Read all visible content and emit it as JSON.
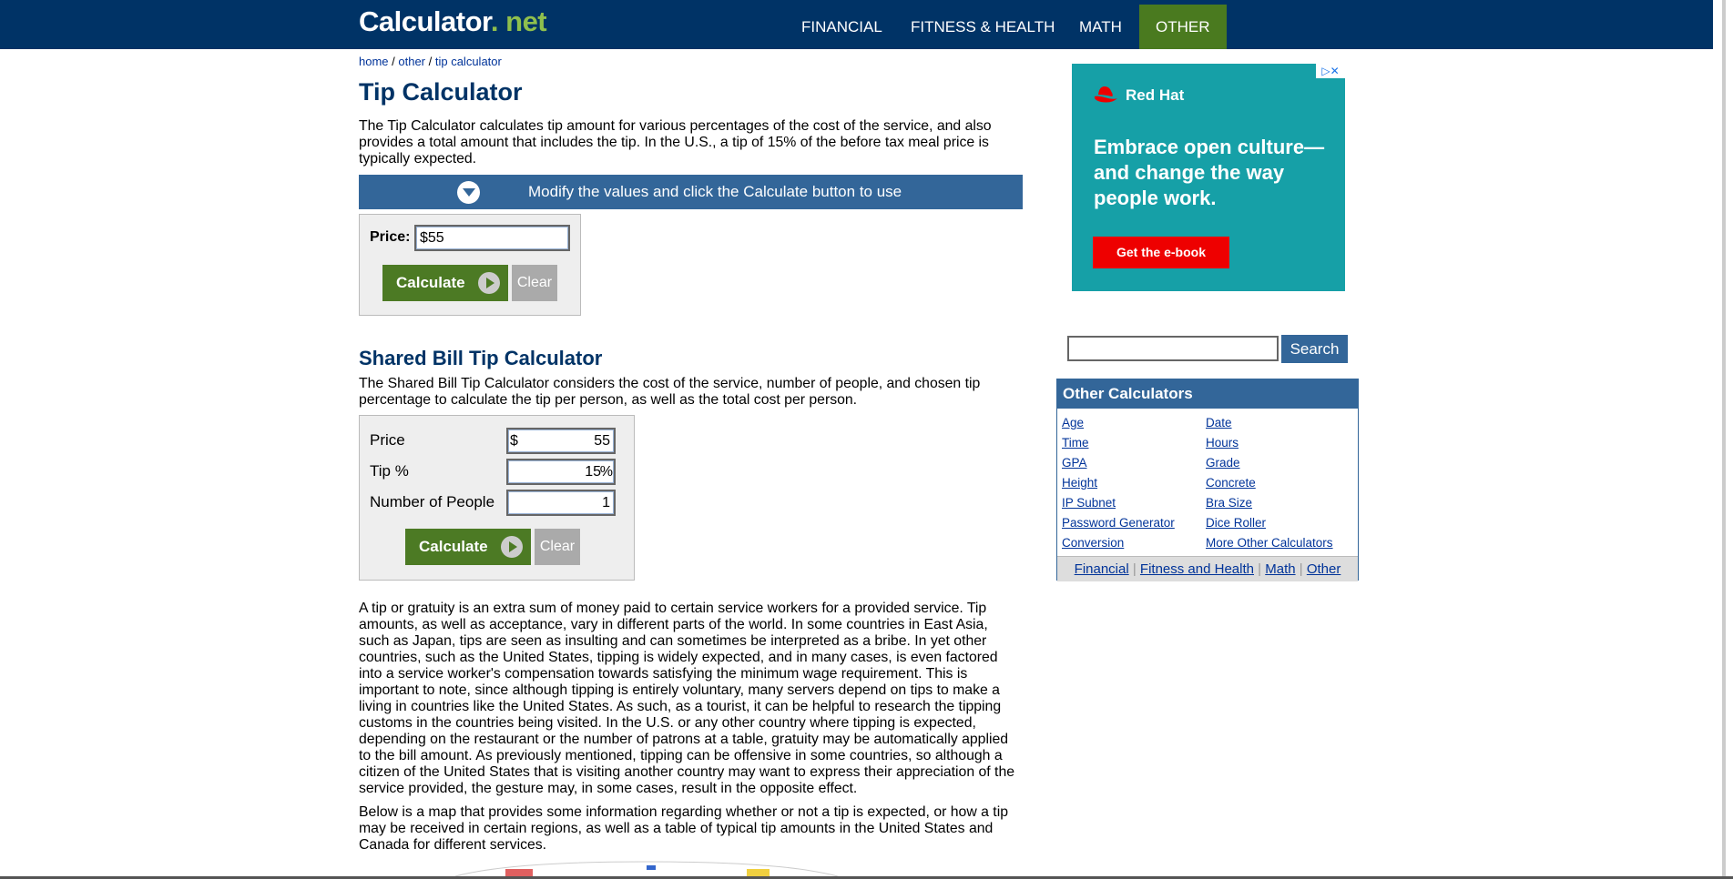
{
  "header": {
    "logo_main": "Calculator",
    "logo_dot": ".",
    "logo_suffix": " net",
    "nav": [
      "FINANCIAL",
      "FITNESS & HEALTH",
      "MATH",
      "OTHER"
    ]
  },
  "breadcrumb": {
    "home": "home",
    "sep1": " / ",
    "other": "other",
    "sep2": " / ",
    "current": "tip calculator"
  },
  "title": "Tip Calculator",
  "intro": "The Tip Calculator calculates tip amount for various percentages of the cost of the service, and also provides a total amount that includes the tip. In the U.S., a tip of 15% of the before tax meal price is typically expected.",
  "modify_bar": "Modify the values and click the Calculate button to use",
  "simple_form": {
    "price_label": "Price:",
    "price_value": "$55",
    "calc_label": "Calculate",
    "clear_label": "Clear"
  },
  "shared": {
    "heading": "Shared Bill Tip Calculator",
    "desc": "The Shared Bill Tip Calculator considers the cost of the service, number of people, and chosen tip percentage to calculate the tip per person, as well as the total cost per person.",
    "price_label": "Price",
    "price_prefix": "$",
    "price_value": "55",
    "tip_label": "Tip %",
    "tip_value": "15",
    "tip_suffix": "%",
    "people_label": "Number of People",
    "people_value": "1",
    "calc_label": "Calculate",
    "clear_label": "Clear"
  },
  "body_para1": "A tip or gratuity is an extra sum of money paid to certain service workers for a provided service. Tip amounts, as well as acceptance, vary in different parts of the world. In some countries in East Asia, such as Japan, tips are seen as insulting and can sometimes be interpreted as a bribe. In yet other countries, such as the United States, tipping is widely expected, and in many cases, is even factored into a service worker's compensation towards satisfying the minimum wage requirement. This is important to note, since although tipping is entirely voluntary, many servers depend on tips to make a living in countries like the United States. As such, as a tourist, it can be helpful to research the tipping customs in the countries being visited. In the U.S. or any other country where tipping is expected, depending on the restaurant or the number of patrons at a table, gratuity may be automatically applied to the bill amount. As previously mentioned, tipping can be offensive in some countries, so although a citizen of the United States that is visiting another country may want to express their appreciation of the service provided, the gesture may, in some cases, result in the opposite effect.",
  "body_para2": "Below is a map that provides some information regarding whether or not a tip is expected, or how a tip may be received in certain regions, as well as a table of typical tip amounts in the United States and Canada for different services.",
  "ad": {
    "brand": "Red Hat",
    "headline": "Embrace open culture—and change the way people work.",
    "cta": "Get the e-book",
    "badge": "▷✕"
  },
  "search": {
    "button": "Search"
  },
  "other_calcs": {
    "title": "Other Calculators",
    "col1": [
      "Age",
      "Time",
      "GPA",
      "Height",
      "IP Subnet",
      "Password Generator",
      "Conversion"
    ],
    "col2": [
      "Date",
      "Hours",
      "Grade",
      "Concrete",
      "Bra Size",
      "Dice Roller",
      "More Other Calculators"
    ],
    "footer": [
      "Financial",
      "Fitness and Health",
      "Math",
      "Other"
    ],
    "footer_sep": " | "
  },
  "colors": {
    "nav_bg": "#003366",
    "accent_green": "#4c7a24",
    "blue_bar": "#336699",
    "ad_bg": "#16a0a7"
  }
}
